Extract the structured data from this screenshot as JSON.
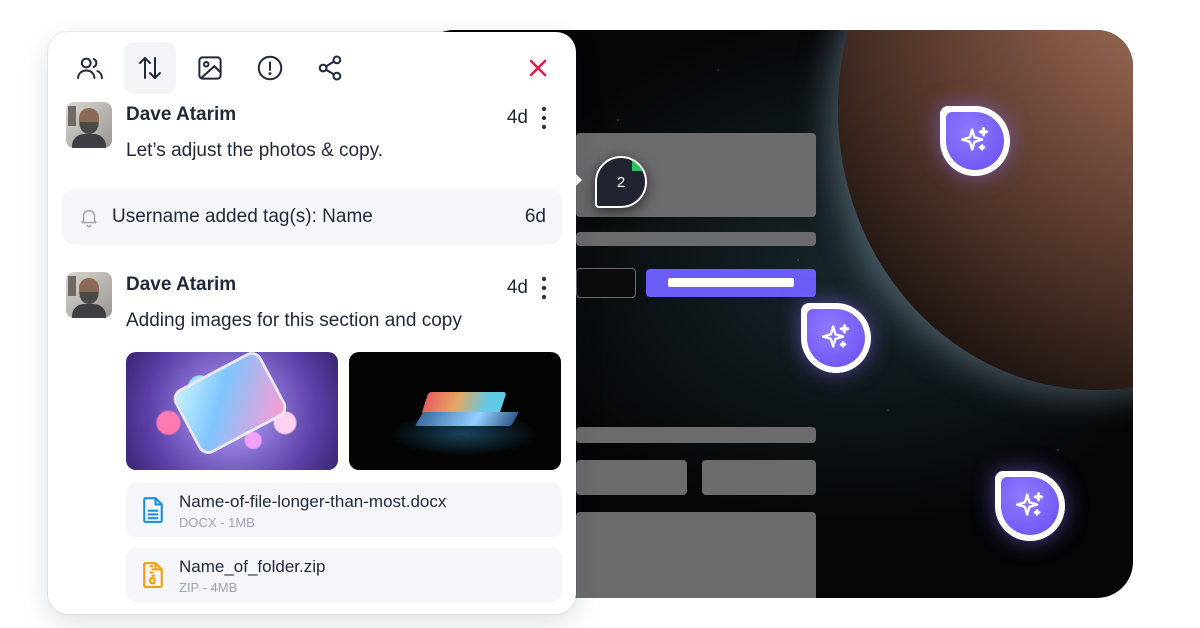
{
  "toolbar": {
    "tools": [
      {
        "name": "users-icon"
      },
      {
        "name": "sort-icon"
      },
      {
        "name": "image-icon"
      },
      {
        "name": "alert-icon"
      },
      {
        "name": "share-icon"
      }
    ],
    "close_color": "#e11d48"
  },
  "comments": [
    {
      "author": "Dave Atarim",
      "time": "4d",
      "message": "Let’s adjust the photos & copy."
    },
    {
      "author": "Dave Atarim",
      "time": "4d",
      "message": "Adding images for this section and copy"
    }
  ],
  "notification": {
    "text": "Username added tag(s): Name",
    "time": "6d"
  },
  "files": [
    {
      "name": "Name-of-file-longer-than-most.docx",
      "meta": "DOCX - 1MB",
      "icon": "document-icon",
      "color": "#1d8fe1"
    },
    {
      "name": "Name_of_folder.zip",
      "meta": "ZIP - 4MB",
      "icon": "zip-file-icon",
      "color": "#f59e0b"
    }
  ],
  "canvas": {
    "comment_count": "2",
    "accent_color": "#6b5df6"
  }
}
